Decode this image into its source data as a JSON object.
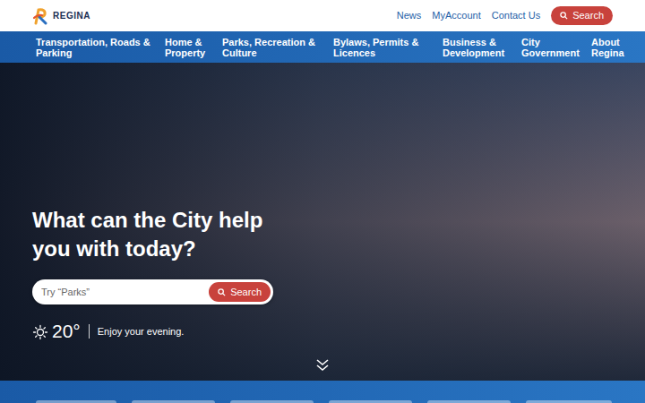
{
  "logo": {
    "text": "REGINA"
  },
  "header_links": [
    "News",
    "MyAccount",
    "Contact Us"
  ],
  "header_search": {
    "label": "Search"
  },
  "nav": [
    {
      "label": "Transportation, Roads & Parking"
    },
    {
      "label": "Home & Property"
    },
    {
      "label": "Parks, Recreation & Culture"
    },
    {
      "label": "Bylaws, Permits & Licences"
    },
    {
      "label": "Business & Development"
    },
    {
      "label": "City Government"
    },
    {
      "label": "About Regina"
    }
  ],
  "hero": {
    "heading": "What can the City help you with today?",
    "search": {
      "placeholder": "Try “Parks”",
      "button": "Search"
    },
    "weather": {
      "temperature": "20°",
      "message": "Enjoy your evening."
    }
  }
}
